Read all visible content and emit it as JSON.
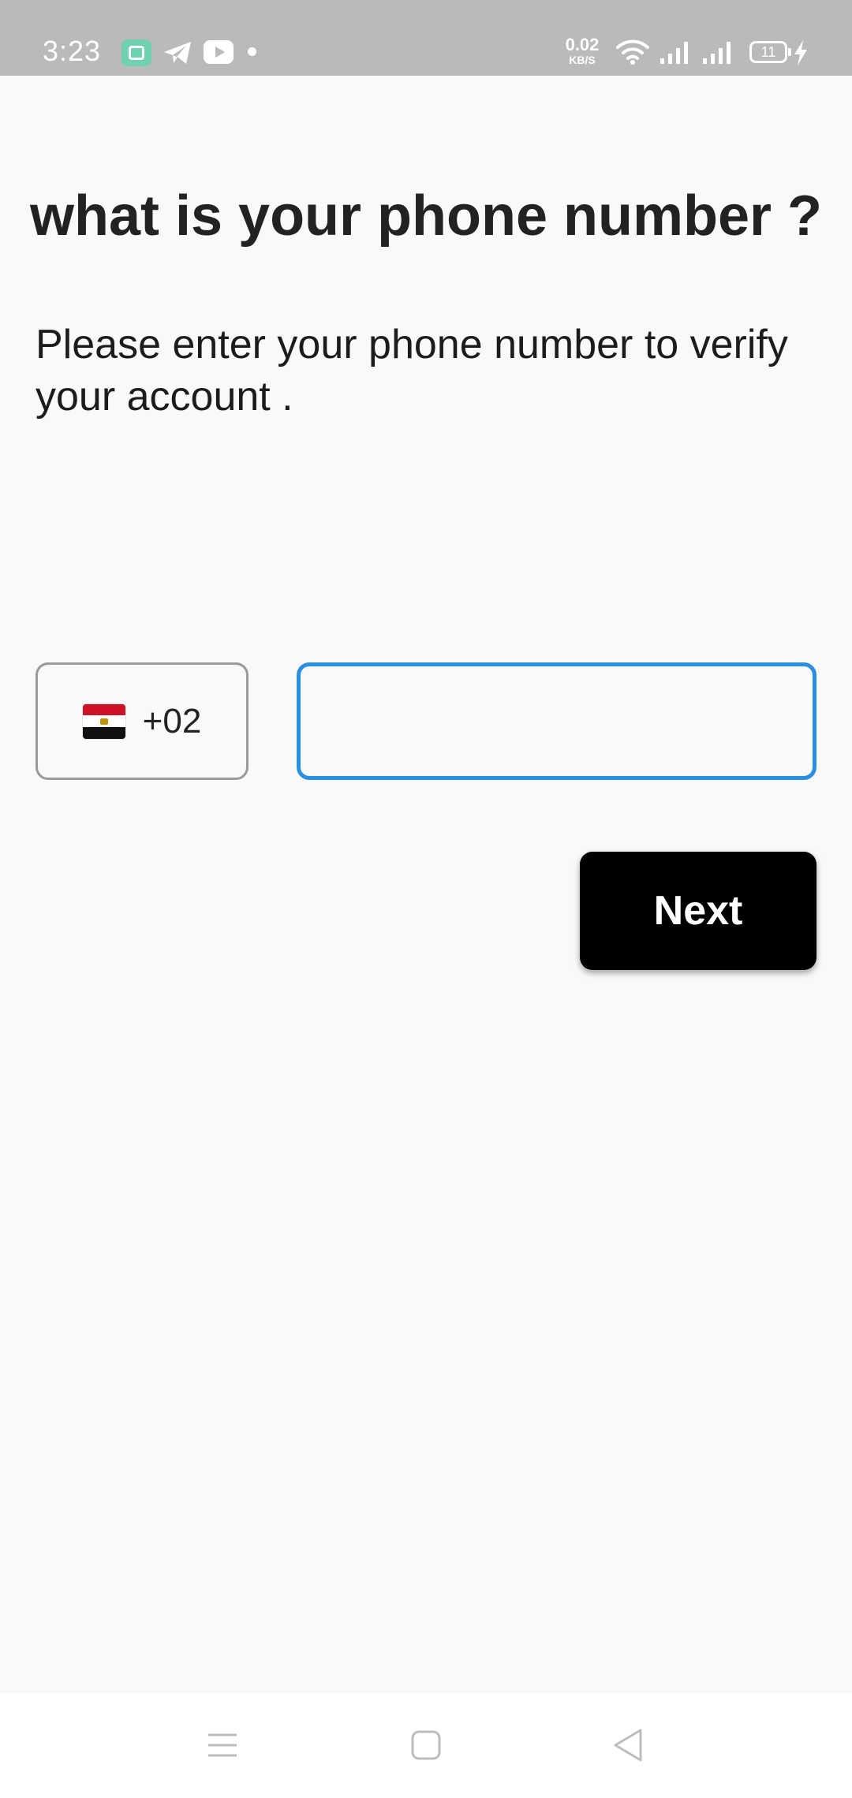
{
  "status_bar": {
    "time": "3:23",
    "net_speed_value": "0.02",
    "net_speed_unit": "KB/S",
    "battery_level": "11",
    "icons": [
      "app-icon",
      "telegram-icon",
      "youtube-icon",
      "dot-icon",
      "wifi-icon",
      "signal-icon",
      "signal-icon",
      "battery-icon",
      "charging-icon"
    ]
  },
  "main": {
    "title": "what is your phone number ?",
    "subtitle": "Please enter your phone number to verify your account .",
    "country": {
      "flag": "egypt-flag",
      "code": "+02"
    },
    "phone_input": {
      "value": "",
      "placeholder": ""
    },
    "next_label": "Next"
  },
  "nav_bar": {
    "icons": [
      "menu-icon",
      "home-icon",
      "back-icon"
    ]
  },
  "colors": {
    "status_bar_bg": "#bababa",
    "page_bg": "#f9f9f9",
    "input_focus_border": "#2a8fe0",
    "button_bg": "#000000",
    "button_text": "#ffffff"
  }
}
